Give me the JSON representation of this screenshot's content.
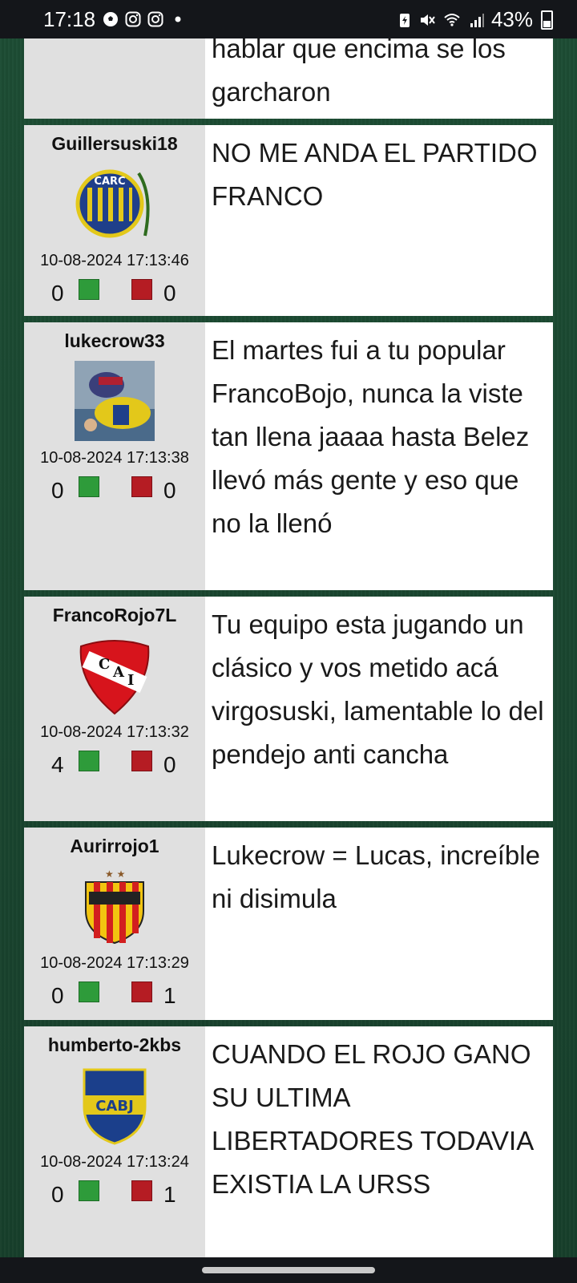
{
  "status_bar": {
    "time": "17:18",
    "battery": "43%",
    "left_icons": [
      "soccer-ball-icon",
      "instagram-icon",
      "instagram-icon",
      "dot-icon"
    ],
    "right_icons": [
      "battery-saver-icon",
      "mute-icon",
      "wifi-icon",
      "signal-icon"
    ]
  },
  "colors": {
    "background": "#1c4a32",
    "card_left": "#e0e0e0",
    "thumb_up": "#2e9b3a",
    "thumb_down": "#b51c23"
  },
  "posts": [
    {
      "message": "hablar que encima se los garcharon"
    },
    {
      "username": "Guillersuski18",
      "avatar": "rosario-central-crest",
      "timestamp": "10-08-2024 17:13:46",
      "likes": "0",
      "dislikes": "0",
      "message": "NO ME ANDA EL PARTIDO FRANCO"
    },
    {
      "username": "lukecrow33",
      "avatar": "football-photo",
      "timestamp": "10-08-2024 17:13:38",
      "likes": "0",
      "dislikes": "0",
      "message": "El martes fui a tu popular FrancoBojo, nunca la viste tan llena jaaaa hasta Belez llevó más gente y eso que no la llenó"
    },
    {
      "username": "FrancoRojo7L",
      "avatar": "independiente-crest",
      "timestamp": "10-08-2024 17:13:32",
      "likes": "4",
      "dislikes": "0",
      "message": "Tu equipo esta jugando un clásico y vos metido acá virgosuski, lamentable lo del pendejo anti cancha"
    },
    {
      "username": "Aurirrojo1",
      "avatar": "boca-unidos-crest",
      "timestamp": "10-08-2024 17:13:29",
      "likes": "0",
      "dislikes": "1",
      "message": "Lukecrow = Lucas, increíble ni disimula"
    },
    {
      "username": "humberto-2kbs",
      "avatar": "boca-juniors-crest",
      "timestamp": "10-08-2024 17:13:24",
      "likes": "0",
      "dislikes": "1",
      "message": "CUANDO EL ROJO GANO SU ULTIMA LIBERTADORES TODAVIA EXISTIA LA URSS"
    }
  ]
}
